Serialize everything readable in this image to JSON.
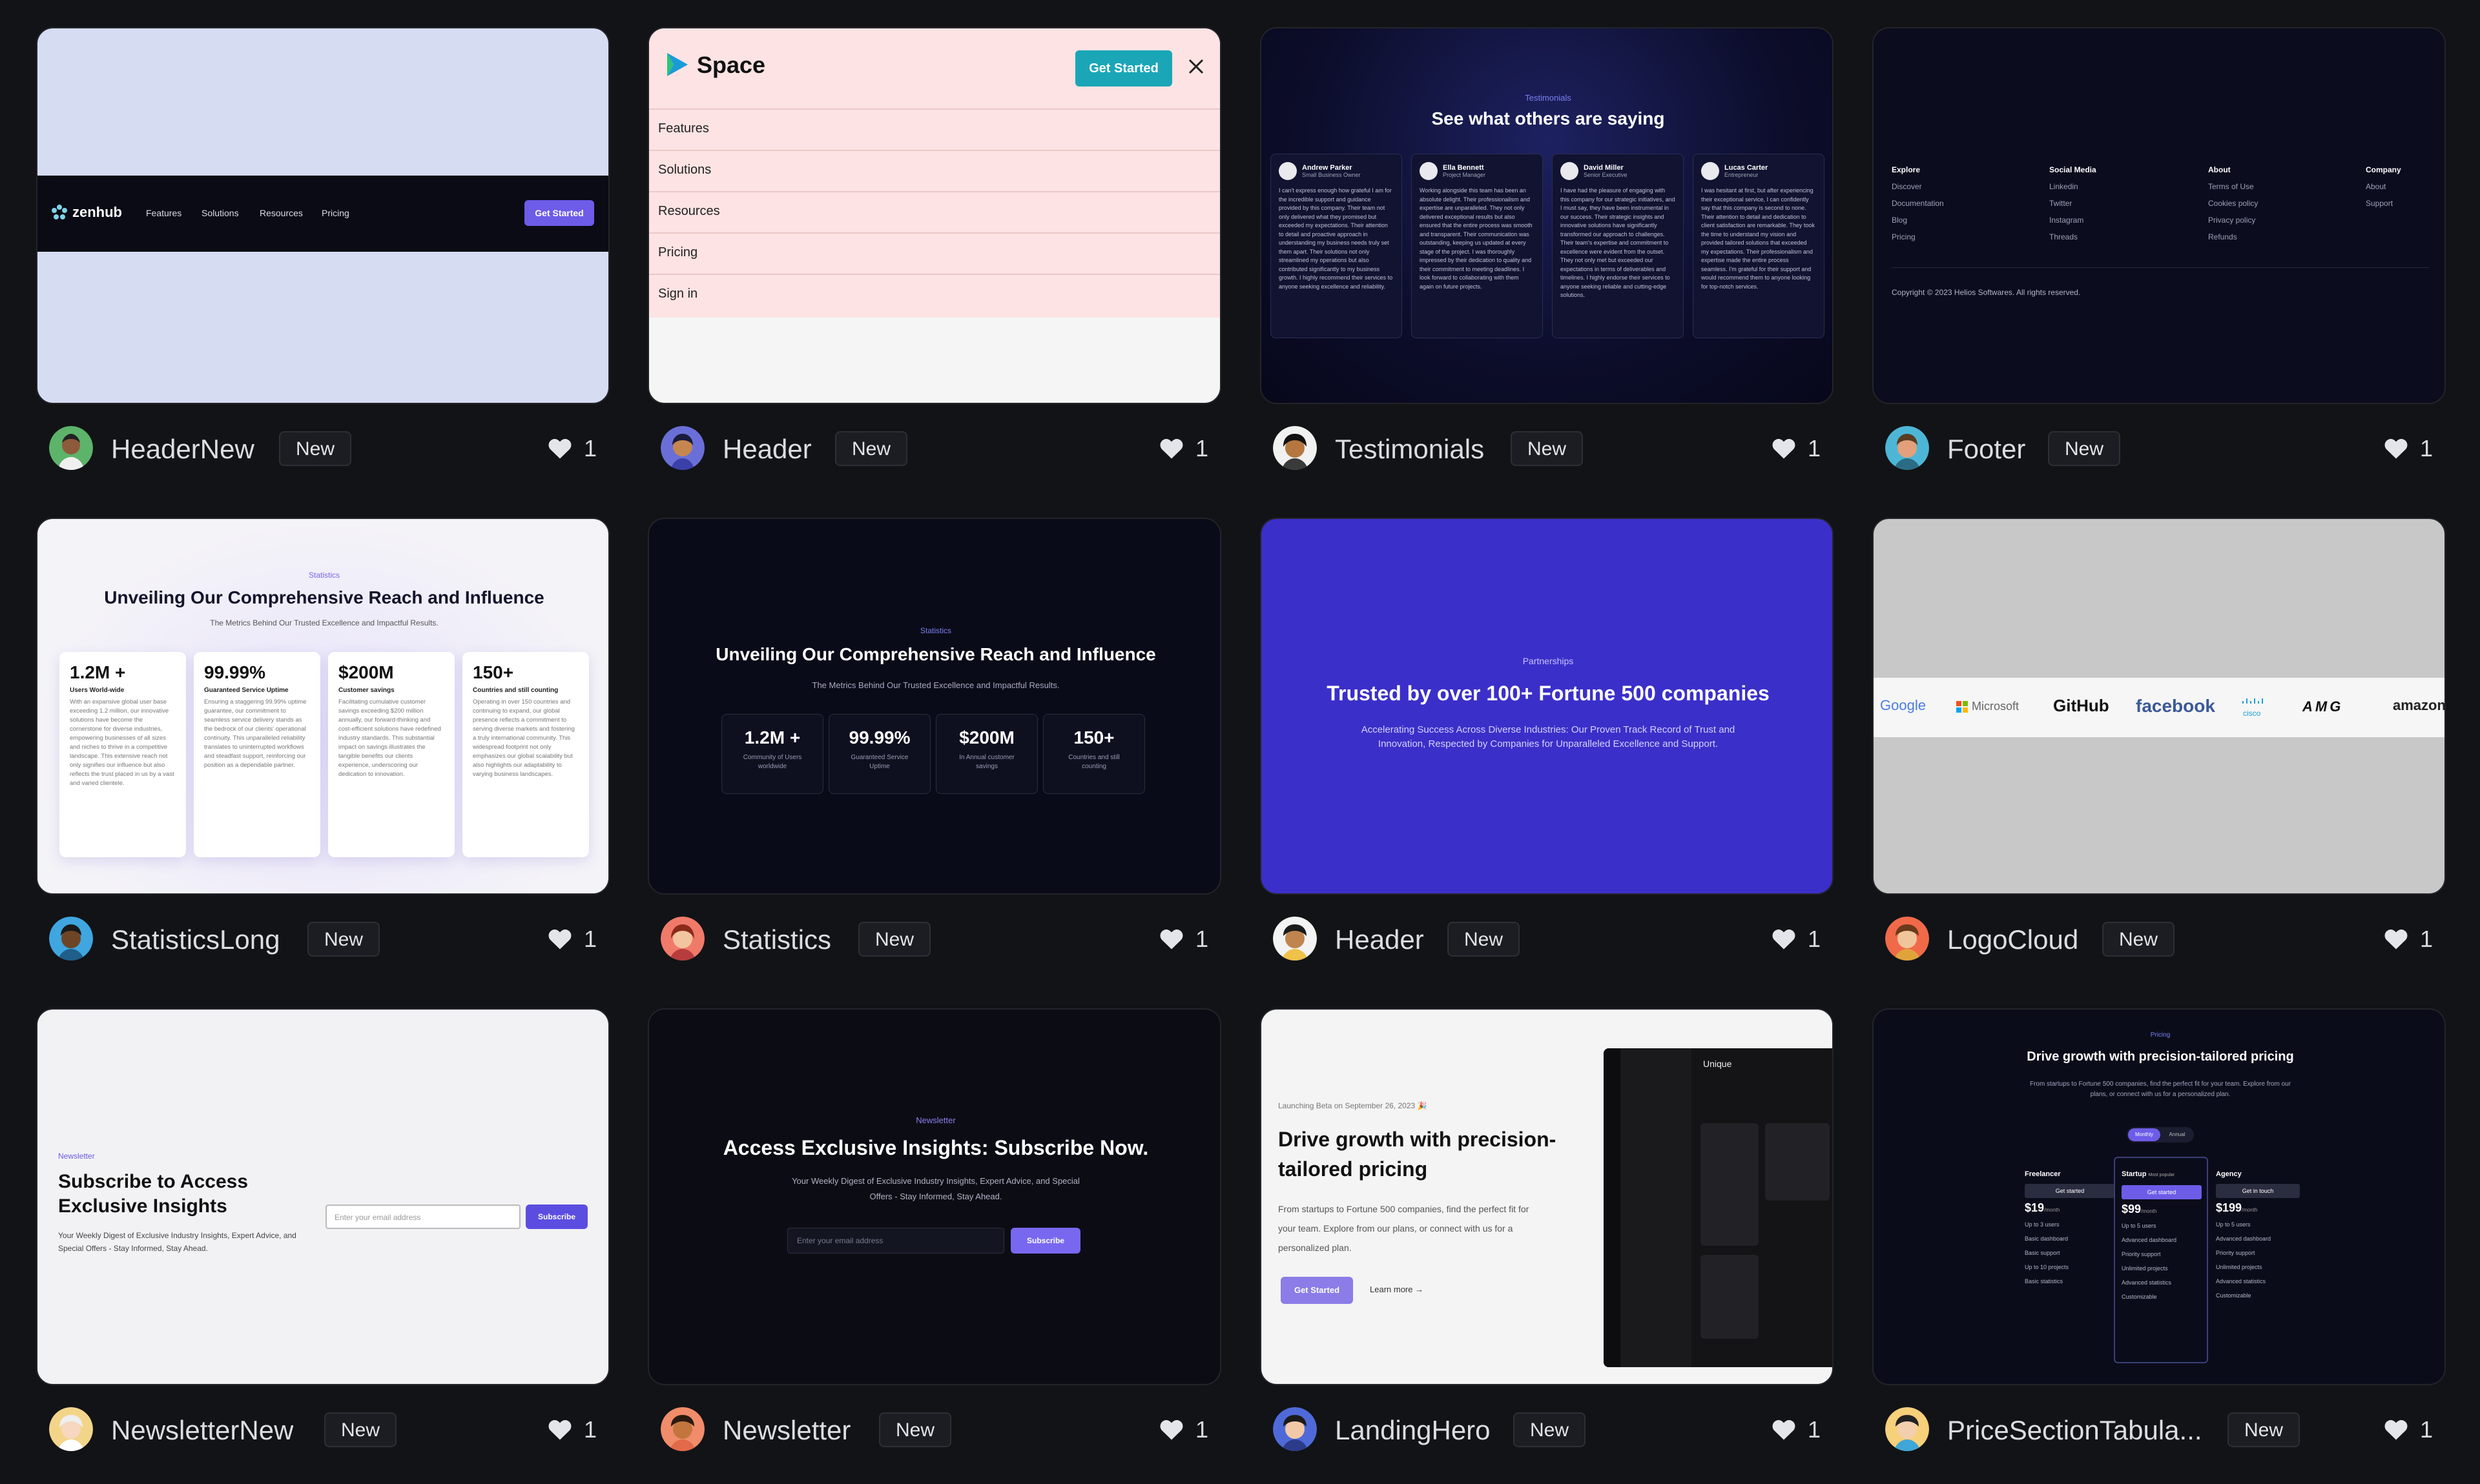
{
  "cards": [
    {
      "title": "HeaderNew",
      "badge": "New",
      "likes": "1",
      "preview": {
        "logo": "zenhub",
        "nav": [
          "Features",
          "Solutions",
          "Resources",
          "Pricing"
        ],
        "cta": "Get Started"
      }
    },
    {
      "title": "Header",
      "badge": "New",
      "likes": "1",
      "preview": {
        "logo": "Space",
        "cta": "Get Started",
        "menu": [
          "Features",
          "Solutions",
          "Resources",
          "Pricing",
          "Sign in"
        ]
      }
    },
    {
      "title": "Testimonials",
      "badge": "New",
      "likes": "1",
      "preview": {
        "eyebrow": "Testimonials",
        "heading": "See what others are saying",
        "people": [
          {
            "name": "Andrew Parker",
            "role": "Small Business Owner",
            "quote": "I can't express enough how grateful I am for the incredible support and guidance provided by this company. Their team not only delivered what they promised but exceeded my expectations. Their attention to detail and proactive approach in understanding my business needs truly set them apart. Their solutions not only streamlined my operations but also contributed significantly to my business growth. I highly recommend their services to anyone seeking excellence and reliability."
          },
          {
            "name": "Ella Bennett",
            "role": "Project Manager",
            "quote": "Working alongside this team has been an absolute delight. Their professionalism and expertise are unparalleled. They not only delivered exceptional results but also ensured that the entire process was smooth and transparent. Their communication was outstanding, keeping us updated at every stage of the project. I was thoroughly impressed by their dedication to quality and their commitment to meeting deadlines. I look forward to collaborating with them again on future projects."
          },
          {
            "name": "David Miller",
            "role": "Senior Executive",
            "quote": "I have had the pleasure of engaging with this company for our strategic initiatives, and I must say, they have been instrumental in our success. Their strategic insights and innovative solutions have significantly transformed our approach to challenges. Their team's expertise and commitment to excellence were evident from the outset. They not only met but exceeded our expectations in terms of deliverables and timelines. I highly endorse their services to anyone seeking reliable and cutting-edge solutions."
          },
          {
            "name": "Lucas Carter",
            "role": "Entrepreneur",
            "quote": "I was hesitant at first, but after experiencing their exceptional service, I can confidently say that this company is second to none. Their attention to detail and dedication to client satisfaction are remarkable. They took the time to understand my vision and provided tailored solutions that exceeded my expectations. Their professionalism and expertise made the entire process seamless. I'm grateful for their support and would recommend them to anyone looking for top-notch services."
          }
        ]
      }
    },
    {
      "title": "Footer",
      "badge": "New",
      "likes": "1",
      "preview": {
        "columns": [
          {
            "head": "Explore",
            "items": [
              "Discover",
              "Documentation",
              "Blog",
              "Pricing"
            ]
          },
          {
            "head": "Social Media",
            "items": [
              "Linkedin",
              "Twitter",
              "Instagram",
              "Threads"
            ]
          },
          {
            "head": "About",
            "items": [
              "Terms of Use",
              "Cookies policy",
              "Privacy policy",
              "Refunds"
            ]
          },
          {
            "head": "Company",
            "items": [
              "About",
              "Support"
            ]
          }
        ],
        "copyright": "Copyright © 2023 Helios Softwares. All rights reserved."
      }
    },
    {
      "title": "StatisticsLong",
      "badge": "New",
      "likes": "1",
      "preview": {
        "eyebrow": "Statistics",
        "heading": "Unveiling Our Comprehensive Reach and Influence",
        "sub": "The Metrics Behind Our Trusted Excellence and Impactful Results.",
        "stats": [
          {
            "value": "1.2M +",
            "label": "Users World-wide",
            "text": "With an expansive global user base exceeding 1.2 million, our innovative solutions have become the cornerstone for diverse industries, empowering businesses of all sizes and niches to thrive in a competitive landscape. This extensive reach not only signifies our influence but also reflects the trust placed in us by a vast and varied clientele."
          },
          {
            "value": "99.99%",
            "label": "Guaranteed Service Uptime",
            "text": "Ensuring a staggering 99.99% uptime guarantee, our commitment to seamless service delivery stands as the bedrock of our clients' operational continuity. This unparalleled reliability translates to uninterrupted workflows and steadfast support, reinforcing our position as a dependable partner."
          },
          {
            "value": "$200M",
            "label": "Customer savings",
            "text": "Facilitating cumulative customer savings exceeding $200 million annually, our forward-thinking and cost-efficient solutions have redefined industry standards. This substantial impact on savings illustrates the tangible benefits our clients experience, underscoring our dedication to innovation."
          },
          {
            "value": "150+",
            "label": "Countries and still counting",
            "text": "Operating in over 150 countries and continuing to expand, our global presence reflects a commitment to serving diverse markets and fostering a truly international community. This widespread footprint not only emphasizes our global scalability but also highlights our adaptability to varying business landscapes."
          }
        ]
      }
    },
    {
      "title": "Statistics",
      "badge": "New",
      "likes": "1",
      "preview": {
        "eyebrow": "Statistics",
        "heading": "Unveiling Our Comprehensive Reach and Influence",
        "sub": "The Metrics Behind Our Trusted Excellence and Impactful Results.",
        "stats": [
          {
            "value": "1.2M +",
            "label": "Community of Users worldwide"
          },
          {
            "value": "99.99%",
            "label": "Guaranteed Service Uptime"
          },
          {
            "value": "$200M",
            "label": "In Annual customer savings"
          },
          {
            "value": "150+",
            "label": "Countries and still counting"
          }
        ]
      }
    },
    {
      "title": "Header",
      "badge": "New",
      "likes": "1",
      "preview": {
        "eyebrow": "Partnerships",
        "heading": "Trusted by over 100+ Fortune 500 companies",
        "sub": "Accelerating Success Across Diverse Industries: Our Proven Track Record of Trust and Innovation, Respected by Companies for Unparalleled Excellence and Support."
      }
    },
    {
      "title": "LogoCloud",
      "badge": "New",
      "likes": "1",
      "preview": {
        "logos": [
          "Google",
          "Microsoft",
          "GitHub",
          "facebook",
          "cisco",
          "AMG",
          "amazon"
        ]
      }
    },
    {
      "title": "NewsletterNew",
      "badge": "New",
      "likes": "1",
      "preview": {
        "eyebrow": "Newsletter",
        "heading": "Subscribe to Access Exclusive Insights",
        "sub": "Your Weekly Digest of Exclusive Industry Insights, Expert Advice, and Special Offers - Stay Informed, Stay Ahead.",
        "placeholder": "Enter your email address",
        "cta": "Subscribe"
      }
    },
    {
      "title": "Newsletter",
      "badge": "New",
      "likes": "1",
      "preview": {
        "eyebrow": "Newsletter",
        "heading": "Access Exclusive Insights: Subscribe Now.",
        "sub": "Your Weekly Digest of Exclusive Industry Insights, Expert Advice, and Special Offers - Stay Informed, Stay Ahead.",
        "placeholder": "Enter your email address",
        "cta": "Subscribe"
      }
    },
    {
      "title": "LandingHero",
      "badge": "New",
      "likes": "1",
      "preview": {
        "kicker": "Launching Beta on September 26, 2023 🎉",
        "heading": "Drive growth with precision-tailored pricing",
        "sub": "From startups to Fortune 500 companies, find the perfect fit for your team. Explore from our plans, or connect with us for a personalized plan.",
        "cta": "Get Started",
        "link": "Learn more →",
        "app_title": "Unique"
      }
    },
    {
      "title": "PriceSectionTabula...",
      "badge": "New",
      "likes": "1",
      "preview": {
        "eyebrow": "Pricing",
        "heading": "Drive growth with precision-tailored pricing",
        "sub": "From startups to Fortune 500 companies, find the perfect fit for your team. Explore from our plans, or connect with us for a personalized plan.",
        "toggle": [
          "Monthly",
          "Annual"
        ],
        "plans": [
          {
            "name": "Freelancer",
            "badge": "",
            "cta": "Get started",
            "price": "$19",
            "per": "/month",
            "features": [
              "Up to 3 users",
              "Basic dashboard",
              "Basic support",
              "Up to 10 projects",
              "Basic statistics"
            ]
          },
          {
            "name": "Startup",
            "badge": "Most popular",
            "cta": "Get started",
            "price": "$99",
            "per": "/month",
            "features": [
              "Up to 5 users",
              "Advanced dashboard",
              "Priority support",
              "Unlimited projects",
              "Advanced statistics",
              "Customizable"
            ]
          },
          {
            "name": "Agency",
            "badge": "",
            "cta": "Get in touch",
            "price": "$199",
            "per": "/month",
            "features": [
              "Up to 5 users",
              "Advanced dashboard",
              "Priority support",
              "Unlimited projects",
              "Advanced statistics",
              "Customizable"
            ]
          }
        ]
      }
    }
  ]
}
